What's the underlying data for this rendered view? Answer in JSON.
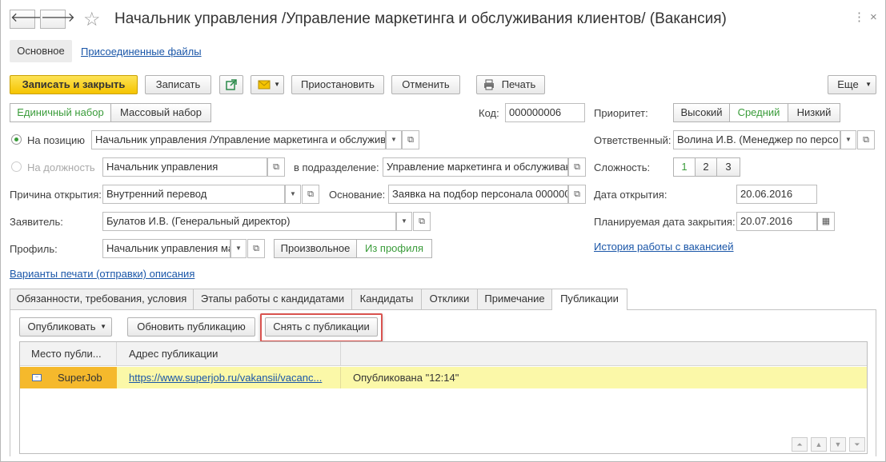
{
  "window": {
    "title": "Начальник управления /Управление маркетинга и обслуживания клиентов/ (Вакансия)"
  },
  "nav": {
    "back": "🡐",
    "forward": "🡒",
    "star": "☆"
  },
  "sections": {
    "main": "Основное",
    "files": "Присоединенные файлы"
  },
  "toolbar": {
    "save_close": "Записать и закрыть",
    "save": "Записать",
    "suspend": "Приостановить",
    "cancel": "Отменить",
    "print": "Печать",
    "more": "Еще"
  },
  "mode": {
    "single": "Единичный набор",
    "mass": "Массовый набор"
  },
  "code": {
    "label": "Код:",
    "value": "000000006"
  },
  "priority": {
    "label": "Приоритет:",
    "options": [
      "Высокий",
      "Средний",
      "Низкий"
    ],
    "selected": "Средний"
  },
  "position": {
    "label": "На позицию",
    "value": "Начальник управления /Управление маркетинга и обслужив"
  },
  "job": {
    "label": "На должность",
    "value": "Начальник управления",
    "dept_label": "в подразделение:",
    "dept_value": "Управление маркетинга и обслуживан"
  },
  "responsible": {
    "label": "Ответственный:",
    "value": "Волина И.В. (Менеджер по персо"
  },
  "complexity": {
    "label": "Сложность:",
    "options": [
      "1",
      "2",
      "3"
    ],
    "selected": "1"
  },
  "reason": {
    "label": "Причина открытия:",
    "value": "Внутренний перевод",
    "basis_label": "Основание:",
    "basis_value": "Заявка на подбор персонала 000000"
  },
  "open_date": {
    "label": "Дата открытия:",
    "value": "20.06.2016"
  },
  "applicant": {
    "label": "Заявитель:",
    "value": "Булатов И.В. (Генеральный директор)"
  },
  "close_date": {
    "label": "Планируемая дата закрытия:",
    "value": "20.07.2016"
  },
  "profile": {
    "label": "Профиль:",
    "value": "Начальник управления ма",
    "arbitrary": "Произвольное",
    "from_profile": "Из профиля",
    "selected": "Из профиля"
  },
  "history_link": "История работы с вакансией",
  "print_variants_link": "Варианты печати (отправки) описания",
  "tabs": [
    {
      "label": "Обязанности, требования, условия"
    },
    {
      "label": "Этапы работы с кандидатами"
    },
    {
      "label": "Кандидаты"
    },
    {
      "label": "Отклики"
    },
    {
      "label": "Примечание"
    },
    {
      "label": "Публикации"
    }
  ],
  "active_tab": "Публикации",
  "pub_toolbar": {
    "publish": "Опубликовать",
    "update": "Обновить публикацию",
    "remove": "Снять с публикации"
  },
  "table": {
    "columns": [
      "Место публи...",
      "Адрес публикации",
      ""
    ],
    "rows": [
      {
        "place": "SuperJob",
        "url": "https://www.superjob.ru/vakansii/vacanc...",
        "status": "Опубликована \"12:14\""
      }
    ]
  },
  "colors": {
    "accent_yellow": "#f5c400",
    "row_highlight": "#fbf8a8",
    "selected_cell": "#f5b92c",
    "highlight_border": "#d9534f",
    "link": "#1a56a8",
    "selected_green": "#3a9c3a"
  }
}
